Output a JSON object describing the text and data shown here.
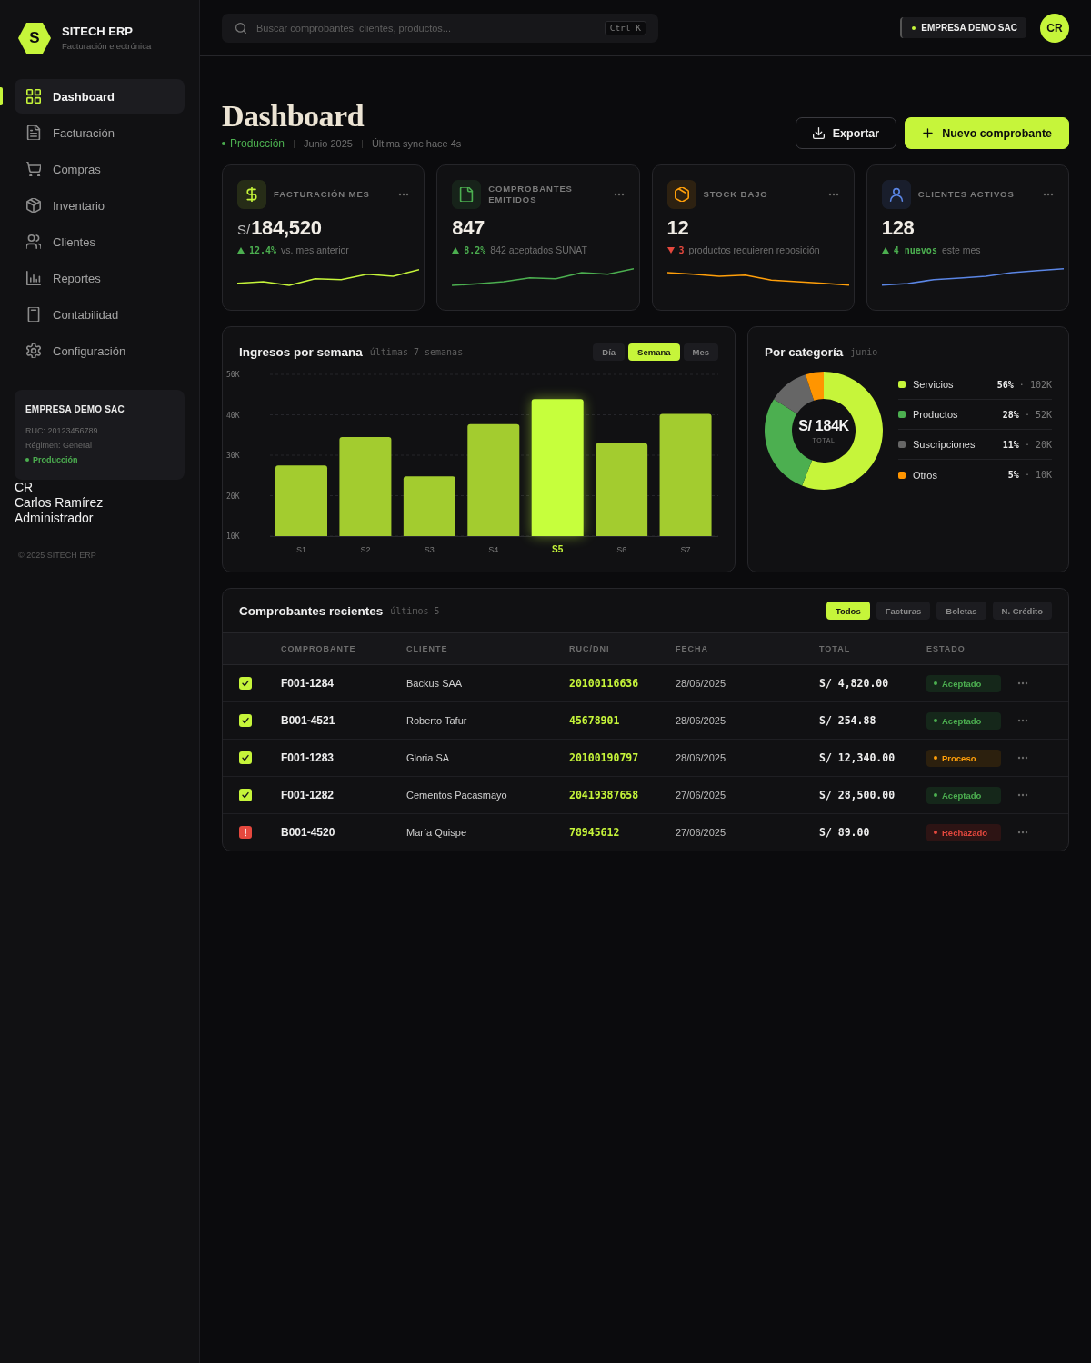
{
  "sidebar": {
    "brand": {
      "logo": "S",
      "name": "SITECH ERP",
      "tagline": "Facturación electrónica"
    },
    "nav": [
      {
        "label": "Dashboard",
        "selected": true
      },
      {
        "label": "Facturación",
        "selected": false
      },
      {
        "label": "Compras",
        "selected": false
      },
      {
        "label": "Inventario",
        "selected": false
      },
      {
        "label": "Clientes",
        "selected": false
      },
      {
        "label": "Reportes",
        "selected": false
      },
      {
        "label": "Contabilidad",
        "selected": false
      },
      {
        "label": "Configuración",
        "selected": false
      }
    ],
    "company_card": {
      "name": "EMPRESA DEMO SAC",
      "ruc": "RUC: 20123456789",
      "regime": "Régimen: General",
      "environment": "Producción"
    },
    "user": {
      "initials": "CR",
      "name": "Carlos Ramírez",
      "role": "Administrador"
    },
    "footer": "© 2025 SITECH ERP"
  },
  "topbar": {
    "search": {
      "placeholder": "Buscar comprobantes, clientes, productos...",
      "shortcut": "Ctrl K"
    },
    "company": "EMPRESA DEMO SAC",
    "avatar": "CR"
  },
  "page": {
    "title": "Dashboard",
    "environment": "Producción",
    "period": "Junio 2025",
    "sync": "Última sync hace 4s",
    "actions": [
      {
        "label": "Exportar",
        "kind": "secondary"
      },
      {
        "label": "Nuevo comprobante",
        "kind": "primary"
      }
    ]
  },
  "kpis": [
    {
      "label": "FACTURACIÓN MES",
      "currency": "S/",
      "value": "184,520",
      "rising": true,
      "delta": "12.4%",
      "note": "vs. mes anterior",
      "color": "#c6f53a"
    },
    {
      "label": "COMPROBANTES EMITIDOS",
      "value": "847",
      "rising": true,
      "delta": "8.2%",
      "note": "842 aceptados SUNAT",
      "color": "#4caf50"
    },
    {
      "label": "STOCK BAJO",
      "value": "12",
      "rising": false,
      "delta": "3",
      "note": "productos requieren reposición",
      "color": "#ff9f0a"
    },
    {
      "label": "CLIENTES ACTIVOS",
      "value": "128",
      "rising": true,
      "delta": "4 nuevos",
      "note": "este mes",
      "color": "#5b86e5"
    }
  ],
  "weekly": {
    "title": "Ingresos por semana",
    "subtitle": "últimas 7 semanas",
    "ranges": [
      {
        "label": "Día",
        "selected": false
      },
      {
        "label": "Semana",
        "selected": true
      },
      {
        "label": "Mes",
        "selected": false
      }
    ],
    "highlighted": [
      false,
      false,
      false,
      false,
      true,
      false,
      false
    ],
    "chart_data": {
      "type": "bar",
      "categories": [
        "S1",
        "S2",
        "S3",
        "S4",
        "S5",
        "S6",
        "S7"
      ],
      "values": [
        27500,
        34500,
        24800,
        37700,
        43900,
        33000,
        40200
      ],
      "ylim": [
        10000,
        50000
      ],
      "yticks": [
        {
          "value": 50000,
          "label": "50K"
        },
        {
          "value": 40000,
          "label": "40K"
        },
        {
          "value": 30000,
          "label": "30K"
        },
        {
          "value": 20000,
          "label": "20K"
        },
        {
          "value": 10000,
          "label": "10K"
        }
      ],
      "grid": true
    }
  },
  "categories": {
    "title": "Por categoría",
    "subtitle": "junio",
    "total": "S/ 184K",
    "total_label": "TOTAL",
    "legend": [
      {
        "value": "**56%** · 102K",
        "color": "#c6f53a"
      },
      {
        "value": "**28%** · 52K",
        "color": "#4caf50"
      },
      {
        "value": "**11%** · 20K",
        "color": "#666666"
      },
      {
        "value": "**5%** · 10K",
        "color": "#ff9500"
      }
    ],
    "chart_data": {
      "type": "donut",
      "categories": [
        "Servicios",
        "Productos",
        "Suscripciones",
        "Otros"
      ],
      "values": [
        56,
        28,
        11,
        5
      ]
    }
  },
  "recent": {
    "title": "Comprobantes recientes",
    "subtitle": "últimos 5",
    "filters": [
      {
        "label": "Todos",
        "selected": true
      },
      {
        "label": "Facturas",
        "selected": false
      },
      {
        "label": "Boletas",
        "selected": false
      },
      {
        "label": "N. Crédito",
        "selected": false
      }
    ],
    "columns": [
      "COMPROBANTE",
      "CLIENTE",
      "RUC/DNI",
      "FECHA",
      "TOTAL",
      "ESTADO"
    ],
    "rows": [
      {
        "error": false,
        "number": "F001-1284",
        "client": "Backus SAA",
        "doc": "20100116636",
        "date": "28/06/2025",
        "total": "S/ 4,820.00",
        "status": {
          "label": "Aceptado",
          "kind": "accepted"
        }
      },
      {
        "error": false,
        "number": "B001-4521",
        "client": "Roberto Tafur",
        "doc": "45678901",
        "date": "28/06/2025",
        "total": "S/ 254.88",
        "status": {
          "label": "Aceptado",
          "kind": "accepted"
        }
      },
      {
        "error": false,
        "number": "F001-1283",
        "client": "Gloria SA",
        "doc": "20100190797",
        "date": "28/06/2025",
        "total": "S/ 12,340.00",
        "status": {
          "label": "Proceso",
          "kind": "processing"
        }
      },
      {
        "error": false,
        "number": "F001-1282",
        "client": "Cementos Pacasmayo",
        "doc": "20419387658",
        "date": "27/06/2025",
        "total": "S/ 28,500.00",
        "status": {
          "label": "Aceptado",
          "kind": "accepted"
        }
      },
      {
        "error": true,
        "number": "B001-4520",
        "client": "María Quispe",
        "doc": "78945612",
        "date": "27/06/2025",
        "total": "S/ 89.00",
        "status": {
          "label": "Rechazado",
          "kind": "rejected"
        }
      }
    ]
  }
}
